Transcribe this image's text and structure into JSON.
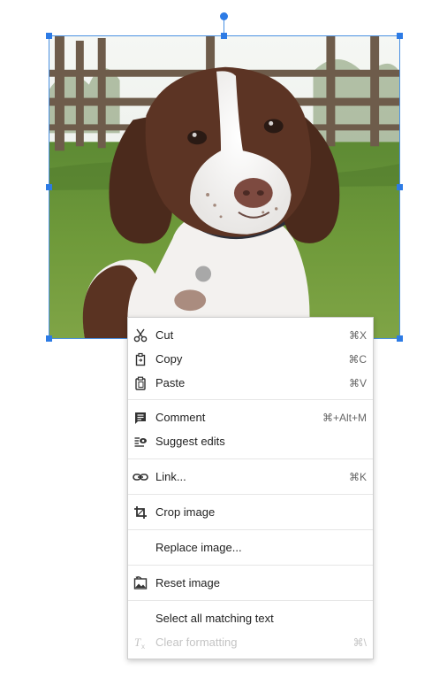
{
  "image": {
    "subject": "spaniel-puppy-photo"
  },
  "context_menu": {
    "cut": {
      "icon": "scissors-icon",
      "label": "Cut",
      "shortcut": "⌘X"
    },
    "copy": {
      "icon": "copy-icon",
      "label": "Copy",
      "shortcut": "⌘C"
    },
    "paste": {
      "icon": "clipboard-icon",
      "label": "Paste",
      "shortcut": "⌘V"
    },
    "comment": {
      "icon": "comment-icon",
      "label": "Comment",
      "shortcut": "⌘+Alt+M"
    },
    "suggest_edits": {
      "icon": "suggest-edits-icon",
      "label": "Suggest edits"
    },
    "link": {
      "icon": "link-icon",
      "label": "Link...",
      "shortcut": "⌘K"
    },
    "crop_image": {
      "icon": "crop-icon",
      "label": "Crop image"
    },
    "replace_image": {
      "label": "Replace image..."
    },
    "reset_image": {
      "icon": "reset-image-icon",
      "label": "Reset image"
    },
    "select_matching": {
      "label": "Select all matching text"
    },
    "clear_formatting": {
      "icon": "clear-formatting-icon",
      "label": "Clear formatting",
      "shortcut": "⌘\\",
      "disabled": true
    }
  },
  "colors": {
    "selection": "#4a90e2",
    "handle": "#2d7be5",
    "menu_text": "#222222",
    "shortcut_text": "#666666",
    "disabled_text": "#c4c4c4"
  }
}
